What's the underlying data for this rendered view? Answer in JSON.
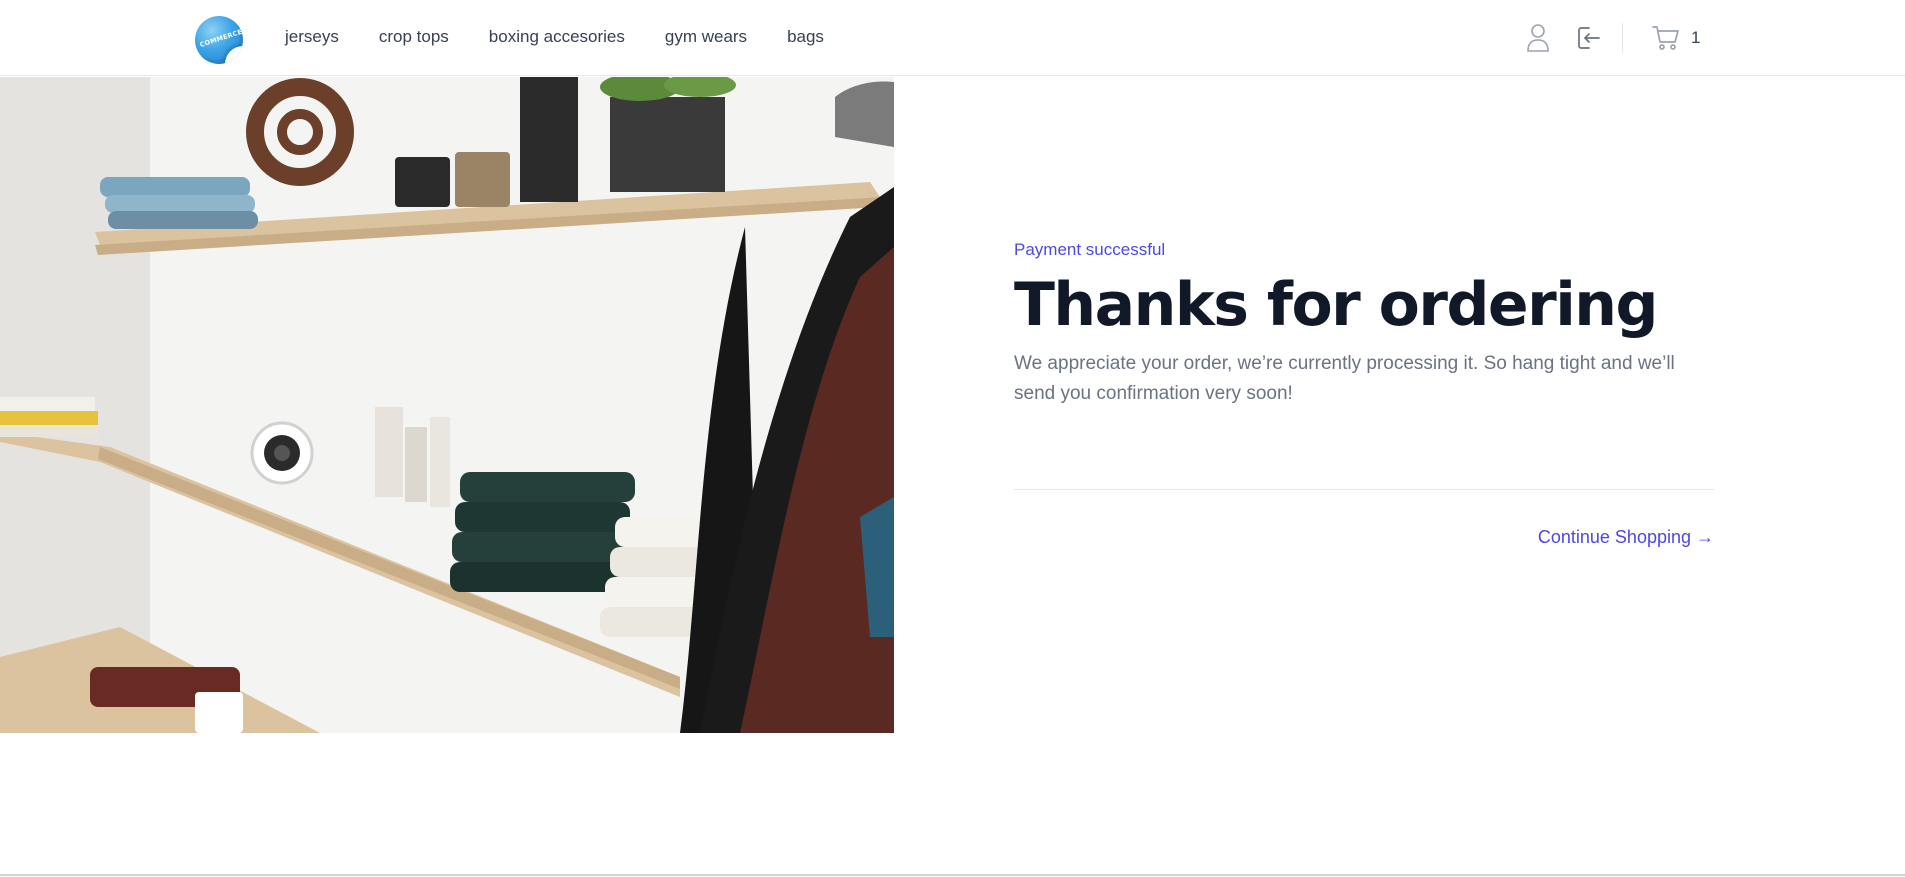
{
  "brand": {
    "logo_text": "COMMERCE"
  },
  "nav": {
    "items": [
      {
        "label": "jerseys"
      },
      {
        "label": "crop tops"
      },
      {
        "label": "boxing accesories"
      },
      {
        "label": "gym wears"
      },
      {
        "label": "bags"
      }
    ]
  },
  "header_icons": {
    "account": "user-icon",
    "logout": "logout-icon",
    "cart": "cart-icon",
    "cart_count": "1"
  },
  "hero": {
    "image": "store-shelves-with-folded-clothes"
  },
  "confirmation": {
    "eyebrow": "Payment successful",
    "title": "Thanks for ordering",
    "message": "We appreciate your order, we’re currently processing it. So hang tight and we’ll send you confirmation very soon!",
    "continue_label": "Continue Shopping →"
  },
  "colors": {
    "accent": "#4f46e5",
    "heading": "#111827",
    "muted": "#6b7280",
    "border": "#e5e7eb"
  }
}
